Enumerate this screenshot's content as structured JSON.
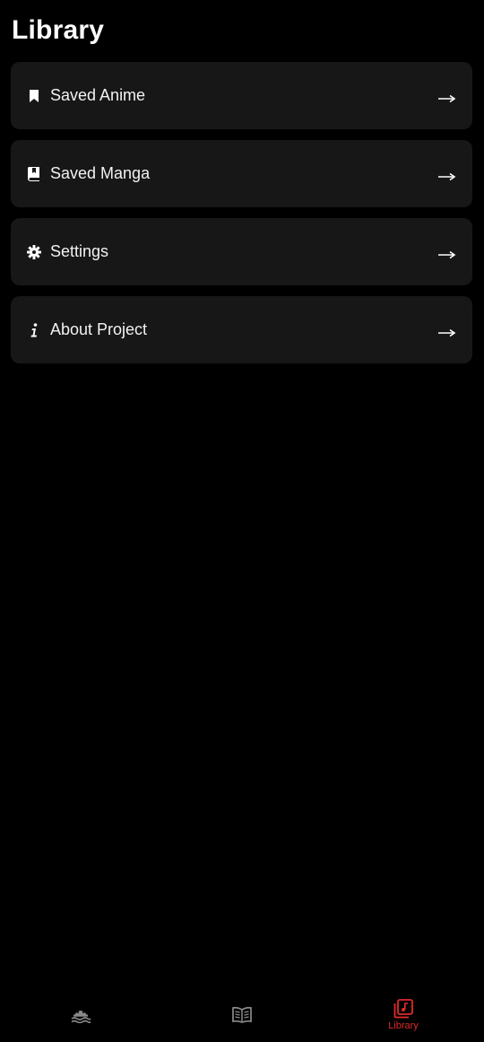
{
  "page": {
    "title": "Library"
  },
  "menu": {
    "items": [
      {
        "label": "Saved Anime",
        "icon": "bookmark-icon"
      },
      {
        "label": "Saved Manga",
        "icon": "book-bookmark-icon"
      },
      {
        "label": "Settings",
        "icon": "gear-icon"
      },
      {
        "label": "About Project",
        "icon": "info-icon"
      }
    ]
  },
  "bottom_nav": {
    "tabs": [
      {
        "icon": "anime-icon",
        "active": false
      },
      {
        "icon": "manga-icon",
        "active": false
      },
      {
        "icon": "library-icon",
        "label": "Library",
        "active": true
      }
    ]
  },
  "colors": {
    "background": "#000000",
    "card": "#171717",
    "accent": "#e02a2a",
    "inactive_icon": "#8a8a8a"
  }
}
